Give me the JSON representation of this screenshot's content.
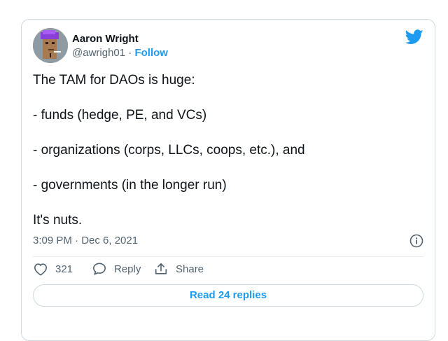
{
  "author": {
    "display_name": "Aaron Wright",
    "handle": "@awrigh01",
    "separator": "·",
    "follow_label": "Follow"
  },
  "tweet": {
    "paragraphs": [
      "The TAM for DAOs is huge:",
      "- funds (hedge, PE, and VCs)",
      "- organizations (corps, LLCs, coops, etc.), and",
      "- governments (in the longer run)",
      "It's nuts."
    ],
    "timestamp": "3:09 PM · Dec 6, 2021"
  },
  "actions": {
    "like_count": "321",
    "reply_label": "Reply",
    "share_label": "Share"
  },
  "read_replies_label": "Read 24 replies",
  "icons": {
    "brand": "twitter-bird-icon",
    "info": "info-icon",
    "like": "heart-icon",
    "reply": "speech-bubble-icon",
    "share": "share-upload-icon"
  },
  "colors": {
    "accent": "#1d9bf0",
    "text": "#0f1419",
    "muted": "#536471",
    "border": "#cfd9de"
  }
}
